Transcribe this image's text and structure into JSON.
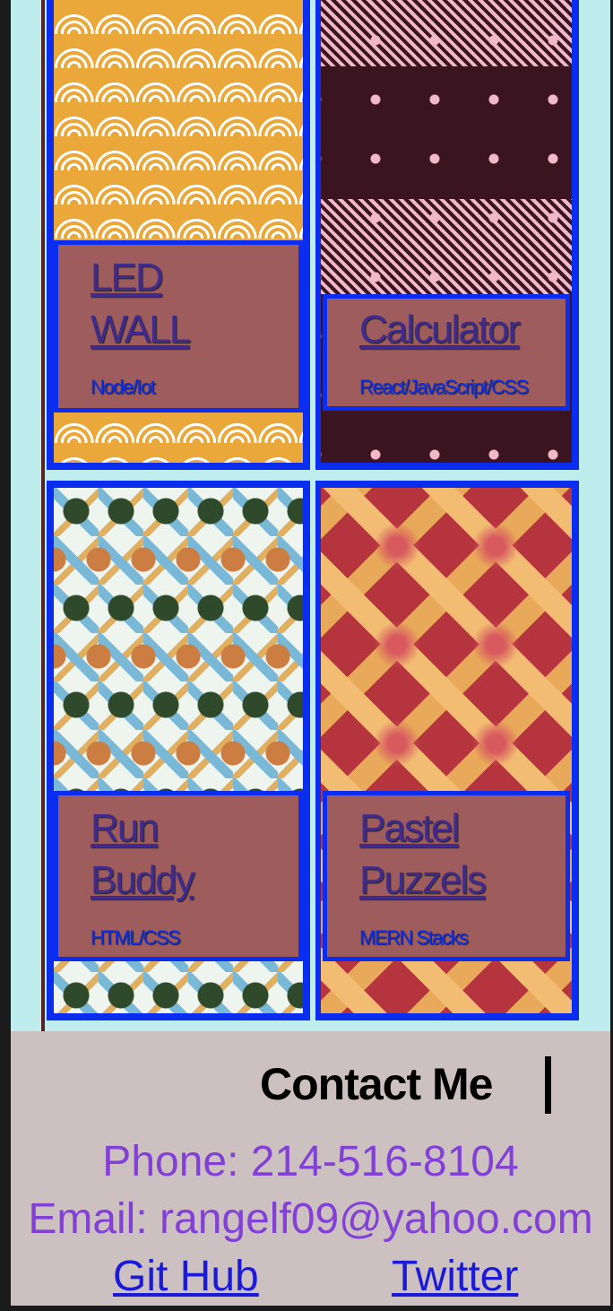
{
  "projects": [
    {
      "title_line1": "LED",
      "title_line2": "WALL",
      "tech": "Node/Iot",
      "pattern": "orange-swirl"
    },
    {
      "title_line1": "Calculator",
      "title_line2": "",
      "tech": "React/JavaScript/CSS",
      "pattern": "maroon-stripes"
    },
    {
      "title_line1": "Run",
      "title_line2": "Buddy",
      "tech": "HTML/CSS",
      "pattern": "geometric"
    },
    {
      "title_line1": "Pastel",
      "title_line2": "Puzzels",
      "tech": "MERN Stacks",
      "pattern": "lattice-pie"
    }
  ],
  "contact": {
    "title": "Contact Me",
    "phone": "Phone: 214-516-8104",
    "email": "Email: rangelf09@yahoo.com",
    "github": "Git Hub",
    "twitter": "Twitter"
  },
  "colors": {
    "card_border": "#0a2df0",
    "info_bg": "#9e5c5c",
    "contact_text": "#8340d6",
    "link": "#1a1ad8",
    "page_bg": "#bfeded",
    "footer_bg": "#ccc0c0"
  }
}
